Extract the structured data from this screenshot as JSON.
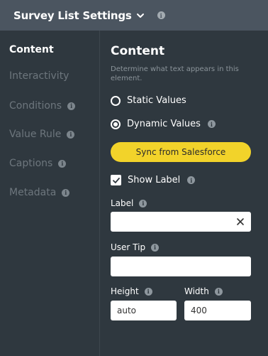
{
  "header": {
    "title": "Survey List Settings",
    "info": "i"
  },
  "sidebar": {
    "items": [
      {
        "label": "Content",
        "active": true,
        "has_info": false
      },
      {
        "label": "Interactivity",
        "active": false,
        "has_info": false
      },
      {
        "label": "Conditions",
        "active": false,
        "has_info": true
      },
      {
        "label": "Value Rule",
        "active": false,
        "has_info": true
      },
      {
        "label": "Captions",
        "active": false,
        "has_info": true
      },
      {
        "label": "Metadata",
        "active": false,
        "has_info": true
      }
    ],
    "info": "i"
  },
  "content": {
    "title": "Content",
    "description": "Determine what text appears in this element.",
    "radios": [
      {
        "label": "Static Values",
        "checked": false
      },
      {
        "label": "Dynamic Values",
        "checked": true
      }
    ],
    "sync_button_label": "Sync from Salesforce",
    "show_label": {
      "label": "Show Label",
      "checked": true
    },
    "label_field": {
      "label": "Label",
      "value": ""
    },
    "user_tip_field": {
      "label": "User Tip",
      "value": ""
    },
    "height_field": {
      "label": "Height",
      "value": "auto"
    },
    "width_field": {
      "label": "Width",
      "value": "400"
    },
    "info": "i"
  },
  "colors": {
    "background": "#2f383f",
    "header": "#4b5560",
    "accent_button": "#f2d32a"
  }
}
